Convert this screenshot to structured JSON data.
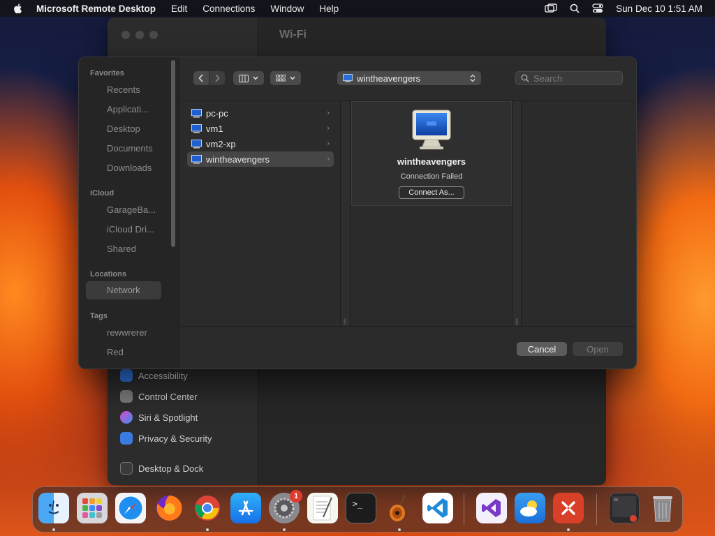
{
  "menubar": {
    "app_name": "Microsoft Remote Desktop",
    "menus": [
      "Edit",
      "Connections",
      "Window",
      "Help"
    ],
    "datetime": "Sun Dec 10  1:51 AM"
  },
  "settings_window": {
    "title": "Wi-Fi",
    "items": [
      {
        "label": "Accessibility",
        "icon": "accessibility-icon",
        "color": "#2f74e0"
      },
      {
        "label": "Control Center",
        "icon": "control-center-icon",
        "color": "#7a7a7a"
      },
      {
        "label": "Siri & Spotlight",
        "icon": "siri-icon",
        "color": "#c040c0"
      },
      {
        "label": "Privacy & Security",
        "icon": "hand-icon",
        "color": "#3a7be0"
      },
      {
        "label": "Desktop & Dock",
        "icon": "dock-icon",
        "color": "#3a3a3a"
      }
    ]
  },
  "dialog": {
    "sidebar": {
      "favorites_header": "Favorites",
      "favorites": [
        "Recents",
        "Applicati...",
        "Desktop",
        "Documents",
        "Downloads"
      ],
      "icloud_header": "iCloud",
      "icloud": [
        "GarageBa...",
        "iCloud Dri...",
        "Shared"
      ],
      "locations_header": "Locations",
      "locations": [
        "Network"
      ],
      "tags_header": "Tags",
      "tags": [
        "rewwrerer",
        "Red"
      ]
    },
    "path_popup": "wintheavengers",
    "search_placeholder": "Search",
    "computers": [
      "pc-pc",
      "vm1",
      "vm2-xp",
      "wintheavengers"
    ],
    "selected_computer": "wintheavengers",
    "preview": {
      "name": "wintheavengers",
      "status": "Connection Failed",
      "button": "Connect As..."
    },
    "cancel_label": "Cancel",
    "open_label": "Open"
  },
  "dock": {
    "apps": [
      "Finder",
      "Launchpad",
      "Safari",
      "Firefox",
      "Chrome",
      "App Store",
      "System Settings",
      "TextEdit",
      "Terminal",
      "GarageBand",
      "VS Code",
      "Visual Studio",
      "iCloud Weather",
      "Remote Desktop",
      "Recent Window",
      "Trash"
    ],
    "settings_badge": "1"
  }
}
